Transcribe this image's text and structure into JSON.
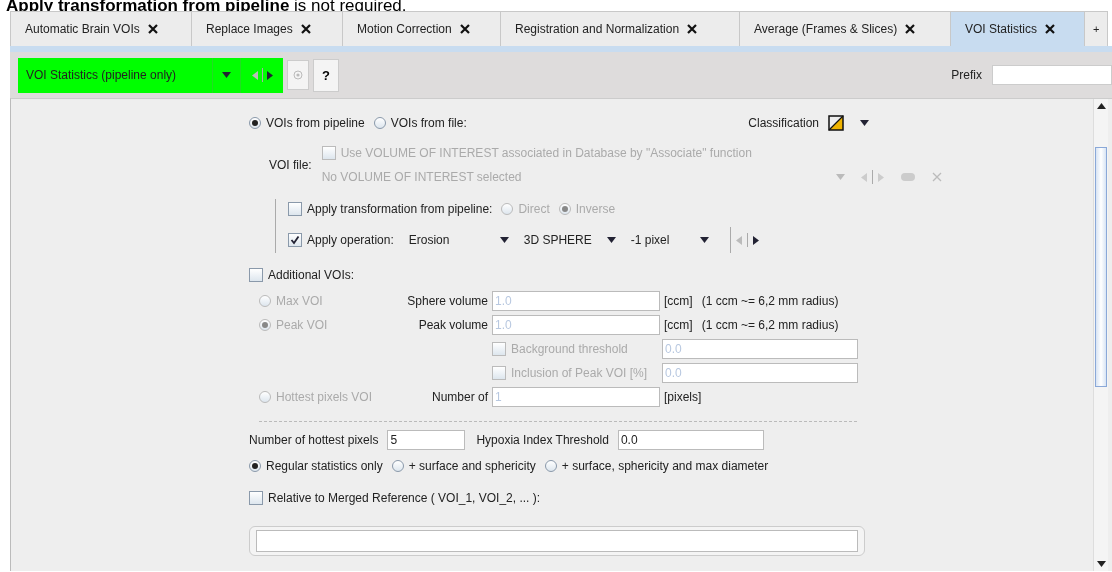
{
  "note": "**Apply transformation from pipeline** is not required.",
  "tabs": [
    {
      "label": "Automatic Brain VOIs",
      "selected": false
    },
    {
      "label": "Replace Images",
      "selected": false
    },
    {
      "label": "Motion Correction",
      "selected": false
    },
    {
      "label": "Registration and Normalization",
      "selected": false
    },
    {
      "label": "Average (Frames & Slices)",
      "selected": false
    },
    {
      "label": "VOI Statistics",
      "selected": true
    }
  ],
  "add_tab": "+",
  "toolbar": {
    "step": "VOI Statistics (pipeline only)",
    "help": "?",
    "prefix_label": "Prefix"
  },
  "voi_source": [
    {
      "label": "VOIs from pipeline",
      "selected": true
    },
    {
      "label": "VOIs from file:",
      "selected": false
    }
  ],
  "classification": "Classification",
  "voi_file": {
    "label": "VOI file:",
    "associate": "Use VOLUME OF INTEREST associated in Database by \"Associate\" function",
    "associate_checked": false,
    "value": "No VOLUME OF INTEREST selected"
  },
  "transformation": {
    "label": "Apply transformation from pipeline:",
    "checked": false,
    "options": [
      {
        "label": "Direct",
        "selected": false
      },
      {
        "label": "Inverse",
        "selected": true
      }
    ]
  },
  "operation": {
    "label": "Apply operation:",
    "checked": true,
    "dropdowns": [
      "Erosion",
      "3D SPHERE",
      "-1 pixel"
    ]
  },
  "additional": {
    "label": "Additional VOIs:",
    "checked": false,
    "rows": [
      {
        "kind": "radio",
        "option": "Max VOI",
        "selected": false,
        "field_label": "Sphere volume",
        "value": "1.0",
        "unit": "[ccm]",
        "hint": "(1 ccm ~= 6,2 mm radius)"
      },
      {
        "kind": "radio",
        "option": "Peak VOI",
        "selected": true,
        "field_label": "Peak volume",
        "value": "1.0",
        "unit": "[ccm]",
        "hint": "(1 ccm ~= 6,2 mm radius)"
      },
      {
        "kind": "checkbox",
        "label": "Background threshold",
        "checked": false,
        "value": "0.0"
      },
      {
        "kind": "checkbox",
        "label": "Inclusion of Peak VOI [%]",
        "checked": false,
        "value": "0.0"
      },
      {
        "kind": "radio",
        "option": "Hottest pixels VOI",
        "selected": false,
        "field_label": "Number of",
        "value": "1",
        "unit": "[pixels]"
      }
    ]
  },
  "stats": {
    "hottest_label": "Number of hottest pixels",
    "hottest_value": "5",
    "hypoxia_label": "Hypoxia Index Threshold",
    "hypoxia_value": "0.0",
    "modes": [
      {
        "label": "Regular statistics only",
        "selected": true
      },
      {
        "label": "+ surface and sphericity",
        "selected": false
      },
      {
        "label": "+ surface, sphericity and max diameter",
        "selected": false
      }
    ]
  },
  "reference": {
    "label": "Relative to Merged Reference ( VOI_1, VOI_2, ... ):",
    "checked": false
  }
}
